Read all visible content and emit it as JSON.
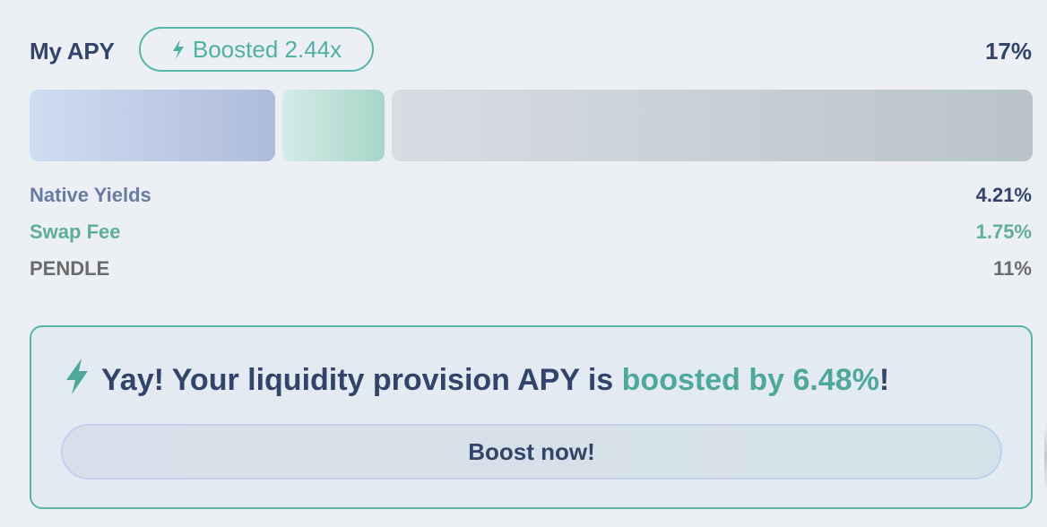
{
  "header": {
    "title": "My APY",
    "boost_badge": "Boosted 2.44x",
    "total_apy": "17%"
  },
  "breakdown": [
    {
      "key": "native",
      "label": "Native Yields",
      "value": "4.21%",
      "color": "#6a7ba4"
    },
    {
      "key": "swap",
      "label": "Swap Fee",
      "value": "1.75%",
      "color": "#5fae99"
    },
    {
      "key": "pendle",
      "label": "PENDLE",
      "value": "11%",
      "color": "#6b6b6b"
    }
  ],
  "notice": {
    "prefix": "Yay! Your liquidity provision APY is ",
    "highlight": "boosted by 6.48%",
    "suffix": "!",
    "button_label": "Boost now!"
  },
  "icons": {
    "badge_icon": "lightning-bolt-icon",
    "notice_icon": "lightning-bolt-icon"
  },
  "colors": {
    "accent": "#56b5a8",
    "text_primary": "#33446a",
    "background": "#eceff4"
  }
}
